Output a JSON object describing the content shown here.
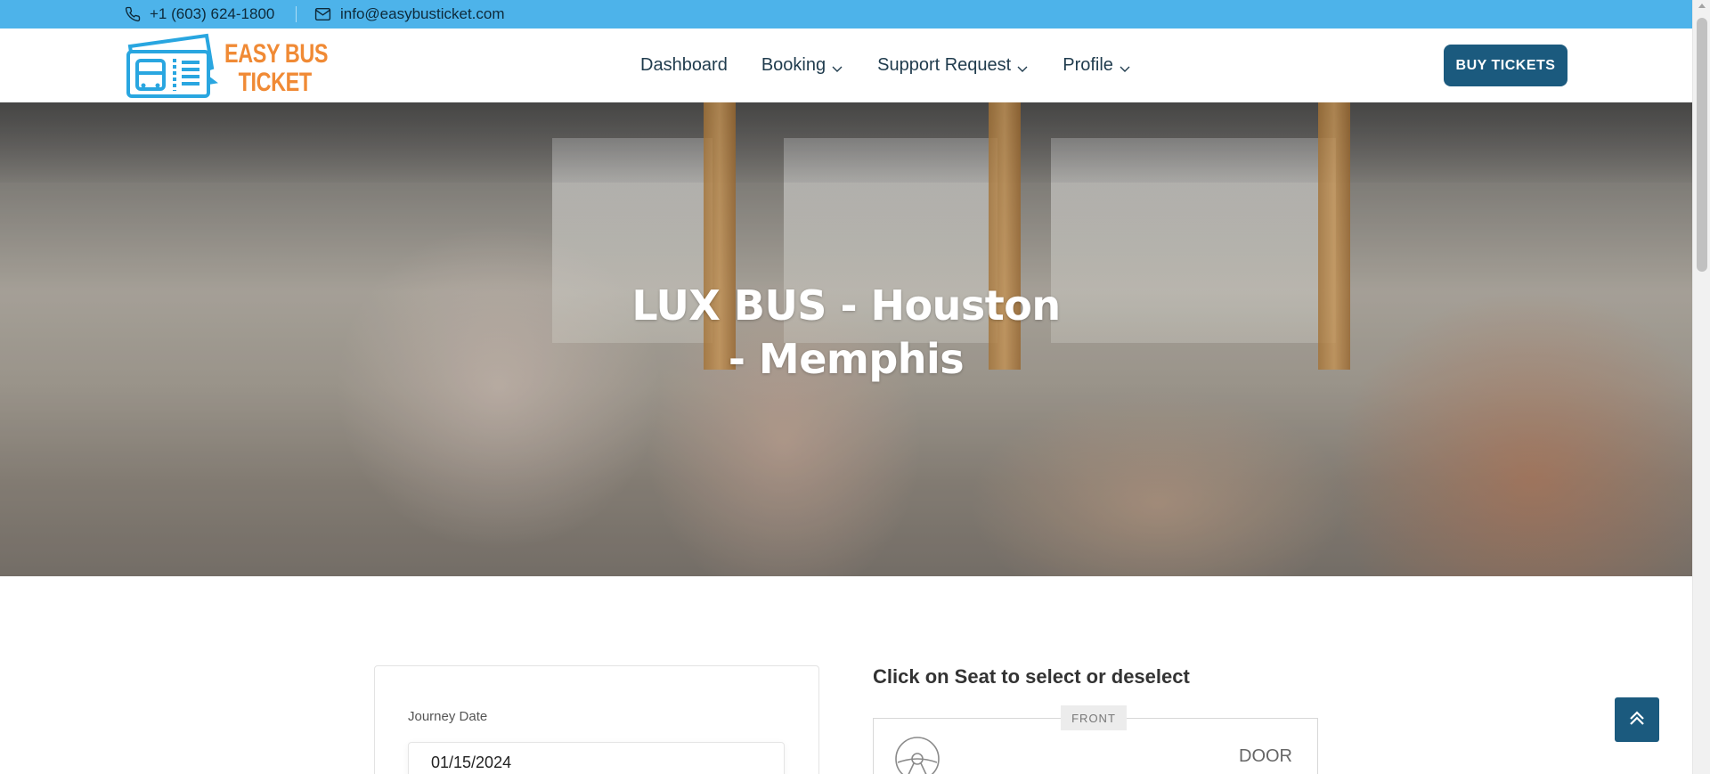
{
  "topbar": {
    "phone": "+1 (603) 624-1800",
    "email": "info@easybusticket.com",
    "phone_icon": "phone-icon",
    "email_icon": "envelope-icon"
  },
  "header": {
    "logo_line1": "EASY BUS",
    "logo_line2": "TICKET",
    "nav": [
      {
        "label": "Dashboard",
        "has_dropdown": false
      },
      {
        "label": "Booking",
        "has_dropdown": true
      },
      {
        "label": "Support Request",
        "has_dropdown": true
      },
      {
        "label": "Profile",
        "has_dropdown": true
      }
    ],
    "buy_button": "BUY TICKETS"
  },
  "hero": {
    "title": "LUX BUS - Houston - Memphis"
  },
  "booking_form": {
    "journey_date_label": "Journey Date",
    "journey_date_value": "01/15/2024"
  },
  "seat_layout": {
    "instruction": "Click on Seat to select or deselect",
    "front_label": "FRONT",
    "door_label": "DOOR"
  },
  "colors": {
    "topbar_bg": "#4db3ea",
    "primary": "#1b5a7e",
    "logo_orange": "#f08a35",
    "logo_blue": "#29a6e0"
  }
}
